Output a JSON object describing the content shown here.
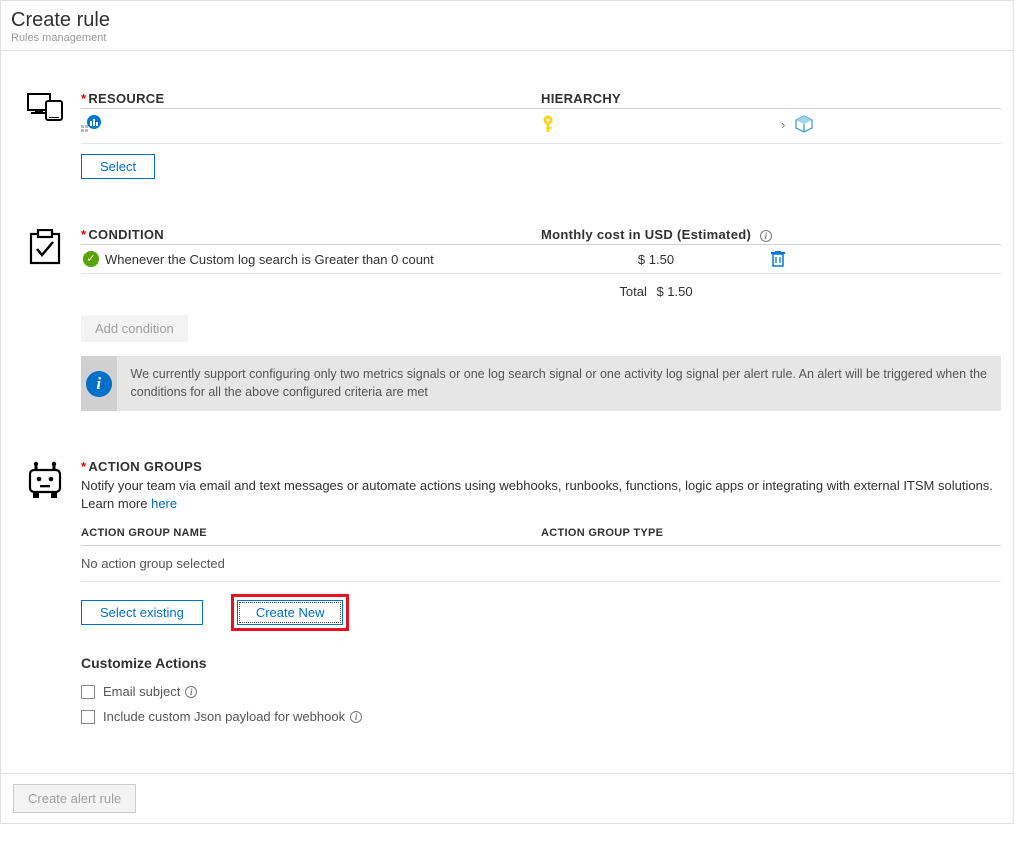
{
  "header": {
    "title": "Create rule",
    "subtitle": "Rules management"
  },
  "resource": {
    "label": "RESOURCE",
    "hierarchy_label": "HIERARCHY",
    "select_btn": "Select"
  },
  "condition": {
    "label": "CONDITION",
    "cost_label": "Monthly cost in USD (Estimated)",
    "item_text": "Whenever the Custom log search is Greater than 0 count",
    "item_cost": "$ 1.50",
    "total_label": "Total",
    "total_value": "$ 1.50",
    "add_btn": "Add condition",
    "info": "We currently support configuring only two metrics signals or one log search signal or one activity log signal per alert rule. An alert will be triggered when the conditions for all the above configured criteria are met"
  },
  "action": {
    "label": "ACTION GROUPS",
    "desc": "Notify your team via email and text messages or automate actions using webhooks, runbooks, functions, logic apps or integrating with external ITSM solutions. Learn more ",
    "learn_link": "here",
    "col_name": "ACTION GROUP NAME",
    "col_type": "ACTION GROUP TYPE",
    "empty": "No action group selected",
    "select_existing": "Select existing",
    "create_new": "Create New",
    "customize_title": "Customize Actions",
    "chk_email": "Email subject",
    "chk_json": "Include custom Json payload for webhook"
  },
  "footer": {
    "create_btn": "Create alert rule"
  }
}
